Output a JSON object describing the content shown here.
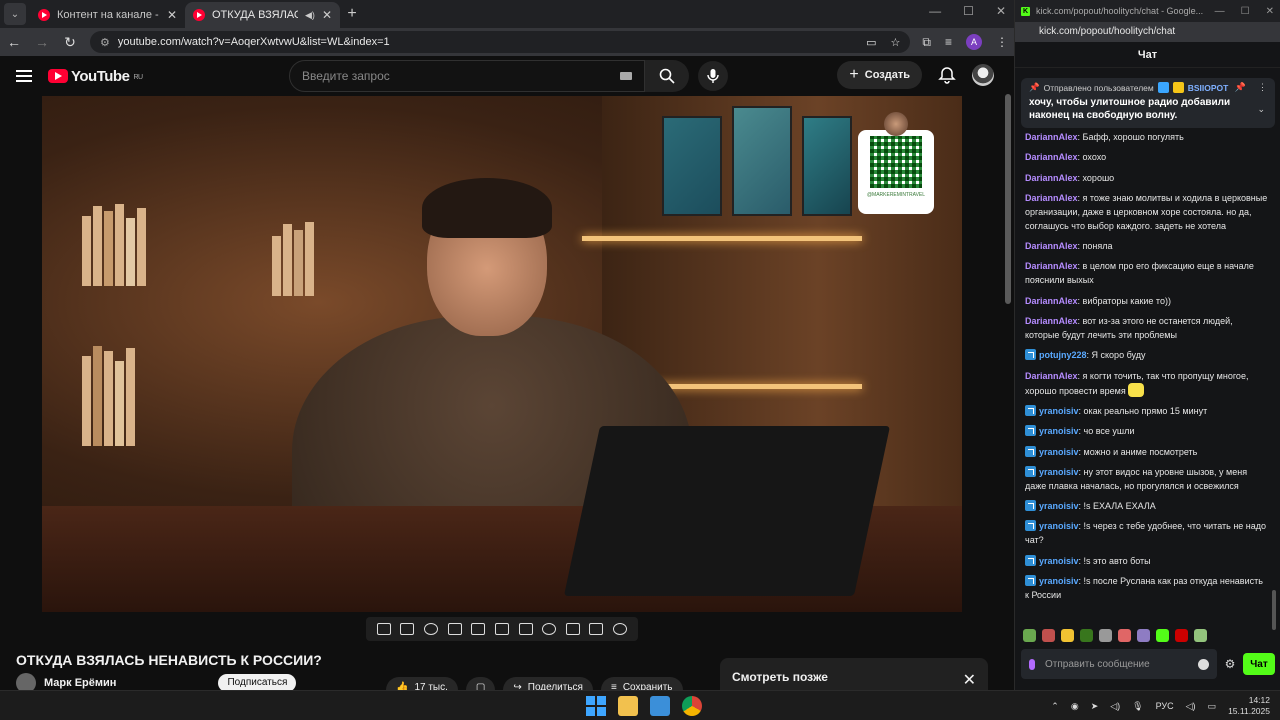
{
  "browser": {
    "tabs": [
      {
        "title": "Контент на канале - YouTube S",
        "active": false
      },
      {
        "title": "ОТКУДА ВЗЯЛАСЬ НЕНАВИ",
        "active": true
      }
    ],
    "url": "youtube.com/watch?v=AoqerXwtvwU&list=WL&index=1"
  },
  "youtube": {
    "logo_text": "YouTube",
    "region": "RU",
    "search_placeholder": "Введите запрос",
    "create_label": "Создать",
    "qr_label": "@MARKEREMINTRAVEL",
    "video_title": "ОТКУДА ВЗЯЛАСЬ НЕНАВИСТЬ К РОССИИ?",
    "channel_name": "Марк Ерёмин",
    "subscribe_label": "Подписаться",
    "likes": "17 тыс.",
    "share_label": "Поделиться",
    "save_label": "Сохранить",
    "watch_later_title": "Смотреть позже"
  },
  "popup": {
    "window_title": "kick.com/popout/hoolitych/chat - Google...",
    "url": "kick.com/popout/hoolitych/chat",
    "chat_title": "Чат",
    "pinned": {
      "label": "Отправлено пользователем",
      "user": "BSIIOPOT",
      "message": "хочу, чтобы улитошное радио добавили наконец на свободную волну."
    },
    "messages": [
      {
        "user": "DariannAlex",
        "color": "#b58cff",
        "badge": false,
        "text": ": Бафф, хорошо погулять"
      },
      {
        "user": "DariannAlex",
        "color": "#b58cff",
        "badge": false,
        "text": ": охохо"
      },
      {
        "user": "DariannAlex",
        "color": "#b58cff",
        "badge": false,
        "text": ": хорошо"
      },
      {
        "user": "DariannAlex",
        "color": "#b58cff",
        "badge": false,
        "text": ": я тоже знаю молитвы и ходила в церковные организации, даже в церковном хоре состояла. но да, соглашусь что выбор каждого. задеть не хотела"
      },
      {
        "user": "DariannAlex",
        "color": "#b58cff",
        "badge": false,
        "text": ": поняла"
      },
      {
        "user": "DariannAlex",
        "color": "#b58cff",
        "badge": false,
        "text": ": в целом про его фиксацию еще в начале пояснили выхых"
      },
      {
        "user": "DariannAlex",
        "color": "#b58cff",
        "badge": false,
        "text": ": вибраторы какие то))"
      },
      {
        "user": "DariannAlex",
        "color": "#b58cff",
        "badge": false,
        "text": ": вот из-за этого не останется людей, которые будут лечить эти проблемы"
      },
      {
        "user": "potujny228",
        "color": "#5aa9ff",
        "badge": true,
        "text": ": Я скоро буду"
      },
      {
        "user": "DariannAlex",
        "color": "#b58cff",
        "badge": false,
        "text": ": я когти точить, так что пропущу многое, хорошо провести время",
        "emote": true
      },
      {
        "user": "yranoisiv",
        "color": "#5aa9ff",
        "badge": true,
        "text": ": окак реально прямо 15 минут"
      },
      {
        "user": "yranoisiv",
        "color": "#5aa9ff",
        "badge": true,
        "text": ": чо все ушли"
      },
      {
        "user": "yranoisiv",
        "color": "#5aa9ff",
        "badge": true,
        "text": ": можно и аниме посмотреть"
      },
      {
        "user": "yranoisiv",
        "color": "#5aa9ff",
        "badge": true,
        "text": ": ну этот видос на уровне шызов, у меня даже плавка началась, но прогулялся и освежился"
      },
      {
        "user": "yranoisiv",
        "color": "#5aa9ff",
        "badge": true,
        "text": ": !s ЕХАЛА ЕХАЛА"
      },
      {
        "user": "yranoisiv",
        "color": "#5aa9ff",
        "badge": true,
        "text": ": !s через с тебе удобнее, что читать не надо чат?"
      },
      {
        "user": "yranoisiv",
        "color": "#5aa9ff",
        "badge": true,
        "text": ": !s это авто боты"
      },
      {
        "user": "yranoisiv",
        "color": "#5aa9ff",
        "badge": true,
        "text": ": !s после Руслана как раз откуда ненависть к России"
      }
    ],
    "input_placeholder": "Отправить сообщение",
    "send_label": "Чат"
  },
  "taskbar": {
    "lang": "РУС",
    "time": "14:12",
    "date": "15.11.2025"
  }
}
